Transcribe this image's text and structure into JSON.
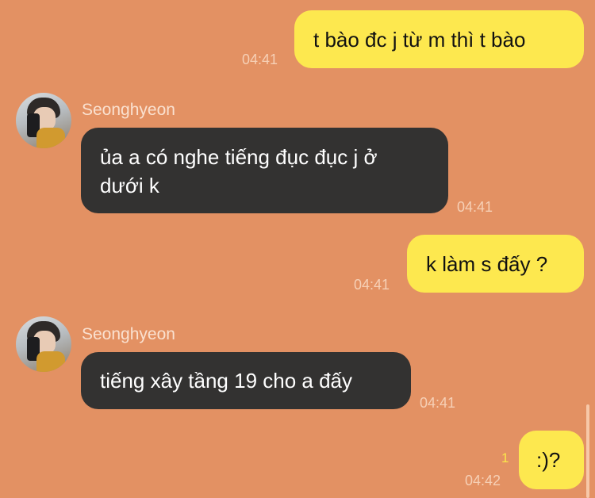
{
  "messages": [
    {
      "side": "mine",
      "text": "t bào đc j từ m thì t bào",
      "time": "04:41"
    },
    {
      "side": "theirs",
      "sender": "Seonghyeon",
      "lines": [
        "ủa a có nghe tiếng đục đục j ở",
        "dưới k"
      ],
      "time": "04:41"
    },
    {
      "side": "mine",
      "text": "k làm s đấy ?",
      "time": "04:41"
    },
    {
      "side": "theirs",
      "sender": "Seonghyeon",
      "lines": [
        "tiếng xây tầng 19 cho a đấy"
      ],
      "time": "04:41"
    },
    {
      "side": "mine",
      "text": ":)?",
      "time": "04:42",
      "unread": "1"
    }
  ],
  "colors": {
    "background": "#e39163",
    "my_bubble": "#fde84f",
    "their_bubble": "#333231",
    "unread": "#fbe64a"
  },
  "icons": {
    "avatar": "profile-photo-avatar"
  }
}
